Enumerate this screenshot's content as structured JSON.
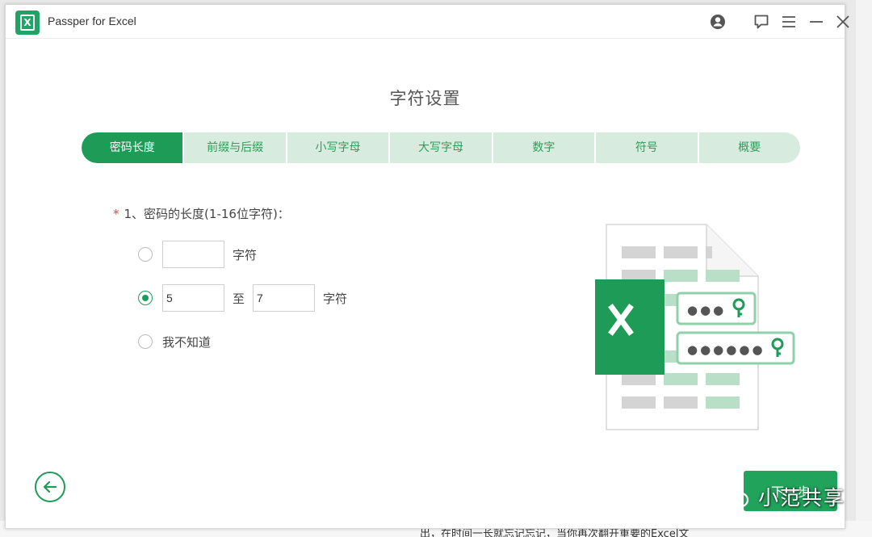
{
  "window": {
    "title": "Passper for Excel"
  },
  "page": {
    "heading": "字符设置"
  },
  "tabs": [
    {
      "label": "密码长度",
      "active": true
    },
    {
      "label": "前缀与后缀",
      "active": false
    },
    {
      "label": "小写字母",
      "active": false
    },
    {
      "label": "大写字母",
      "active": false
    },
    {
      "label": "数字",
      "active": false
    },
    {
      "label": "符号",
      "active": false
    },
    {
      "label": "概要",
      "active": false
    }
  ],
  "form": {
    "required_mark": "*",
    "question": "1、密码的长度(1-16位字符)：",
    "option_exact": {
      "value": "",
      "unit": "字符",
      "selected": false
    },
    "option_range": {
      "from": "5",
      "separator": "至",
      "to": "7",
      "unit": "字符",
      "selected": true
    },
    "option_unknown": {
      "label": "我不知道",
      "selected": false
    }
  },
  "illustration": {
    "short_mask": "●●●",
    "long_mask": "●●●●●●"
  },
  "buttons": {
    "next": "下一步"
  },
  "watermark": {
    "text": "小范共享"
  },
  "background": {
    "bottom_text": "出，在时间一长就忘记忘记，当你再次翻开重要的Excel文"
  },
  "colors": {
    "brand_green": "#1e9b57",
    "tab_bg": "#d7ecdf",
    "required": "#e0493b"
  }
}
